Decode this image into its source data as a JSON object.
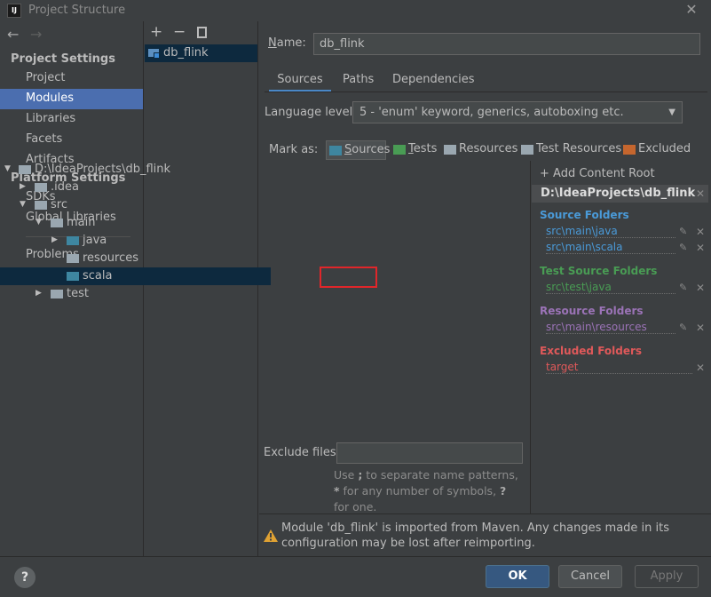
{
  "window": {
    "title": "Project Structure",
    "icon_text": "IJ"
  },
  "nav": {
    "project_settings_header": "Project Settings",
    "project_settings_items": [
      "Project",
      "Modules",
      "Libraries",
      "Facets",
      "Artifacts"
    ],
    "selected": "Modules",
    "platform_settings_header": "Platform Settings",
    "platform_settings_items": [
      "SDKs",
      "Global Libraries"
    ],
    "other_items": [
      "Problems"
    ]
  },
  "modules": {
    "items": [
      "db_flink"
    ]
  },
  "name": {
    "label_prefix": "N",
    "label_rest": "ame:",
    "value": "db_flink"
  },
  "tabs": [
    "Sources",
    "Paths",
    "Dependencies"
  ],
  "active_tab": "Sources",
  "language_level": {
    "label": "Language level:",
    "value": "5 - 'enum' keyword, generics, autoboxing etc."
  },
  "mark_as": {
    "label": "Mark as:",
    "options": [
      {
        "label_u": "S",
        "label_rest": "ources",
        "color": "#3e86a0"
      },
      {
        "label_u": "T",
        "label_rest": "ests",
        "color": "#499c54"
      },
      {
        "label_u": "",
        "label_rest": "Resources",
        "color": "#9aa7b0"
      },
      {
        "label_u": "",
        "label_rest": "Test Resources",
        "color": "#9aa7b0"
      },
      {
        "label_u": "",
        "label_rest": "Excluded",
        "color": "#c5662e"
      }
    ]
  },
  "tree": {
    "rows": [
      "D:\\IdeaProjects\\db_flink",
      ".idea",
      "src",
      "main",
      "java",
      "resources",
      "scala",
      "test"
    ],
    "selected": "scala"
  },
  "content_root": {
    "add_label": "+ Add Content Root",
    "root_path": "D:\\IdeaProjects\\db_flink",
    "source_folders": {
      "title": "Source Folders",
      "items": [
        "src\\main\\java",
        "src\\main\\scala"
      ],
      "color": "#4a9ad8"
    },
    "test_source_folders": {
      "title": "Test Source Folders",
      "items": [
        "src\\test\\java"
      ],
      "color": "#499c54"
    },
    "resource_folders": {
      "title": "Resource Folders",
      "items": [
        "src\\main\\resources"
      ],
      "color": "#9b73b7"
    },
    "excluded_folders": {
      "title": "Excluded Folders",
      "items": [
        "target"
      ],
      "color": "#e0595a"
    }
  },
  "exclude_files": {
    "label": "Exclude files:",
    "value": "",
    "hint_a": "Use ",
    "hint_b": ";",
    "hint_c": " to separate name patterns, ",
    "hint_d": "*",
    "hint_e": " for any number of symbols, ",
    "hint_f": "?",
    "hint_g": " for one."
  },
  "warning": "Module 'db_flink' is imported from Maven. Any changes made in its configuration may be lost after reimporting.",
  "buttons": {
    "help": "?",
    "ok": "OK",
    "cancel": "Cancel",
    "apply": "Apply"
  }
}
